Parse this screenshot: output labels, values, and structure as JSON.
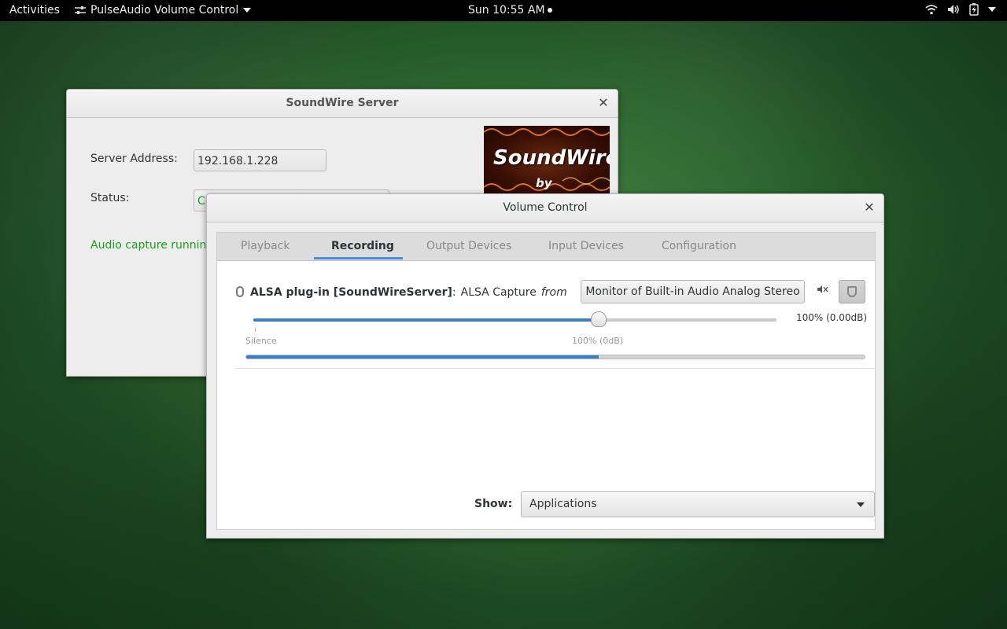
{
  "topbar": {
    "activities": "Activities",
    "app_name": "PulseAudio Volume Control",
    "clock": "Sun 10:55 AM",
    "icons": [
      "wifi-icon",
      "volume-icon",
      "battery-icon",
      "caret-down-icon"
    ]
  },
  "soundwire": {
    "title": "SoundWire Server",
    "server_address_label": "Server Address:",
    "server_address_value": "192.168.1.228",
    "status_label": "Status:",
    "status_value": "C",
    "audio_message": "Audio capture running a",
    "logo_brand": "SoundWire",
    "logo_by": "by",
    "accent_green": "#1aa31a"
  },
  "volume_control": {
    "title": "Volume Control",
    "tabs": [
      {
        "label": "Playback",
        "active": false
      },
      {
        "label": "Recording",
        "active": true
      },
      {
        "label": "Output Devices",
        "active": false
      },
      {
        "label": "Input Devices",
        "active": false
      },
      {
        "label": "Configuration",
        "active": false
      }
    ],
    "stream": {
      "name": "ALSA plug-in [SoundWireServer]",
      "separator": ":",
      "description": "ALSA Capture",
      "from": "from",
      "source_button": "Monitor of Built-in Audio Analog Stereo",
      "volume_text": "100% (0.00dB)",
      "volume_fraction": 0.66,
      "tick_silence": "Silence",
      "tick_100": "100% (0dB)",
      "level_fraction": 0.57
    },
    "show_label": "Show:",
    "show_value": "Applications",
    "accent_blue": "#3d7ec9"
  }
}
